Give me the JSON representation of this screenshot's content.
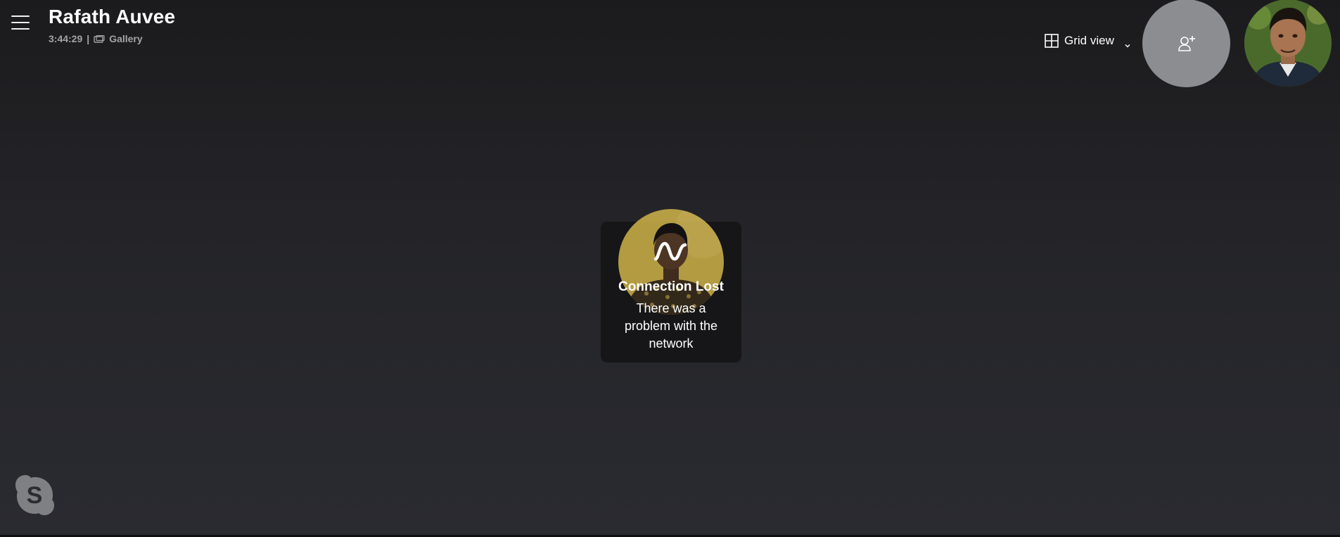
{
  "header": {
    "title": "Rafath Auvee",
    "duration": "3:44:29",
    "separator": "|",
    "gallery_label": "Gallery"
  },
  "view_toggle": {
    "label": "Grid view"
  },
  "connection_status": {
    "title": "Connection Lost",
    "message": "There was a problem with the network"
  },
  "icons": {
    "menu": "hamburger-menu-icon",
    "gallery": "gallery-icon",
    "grid": "grid-view-icon",
    "chevron": "chevron-down-icon",
    "add_person": "add-person-icon",
    "connection": "connection-wave-icon",
    "app": "skype-logo"
  },
  "colors": {
    "background": "#26272c",
    "card": "#161618",
    "add_person_bg": "#8b8d91",
    "avatar_ring": "#d6b94c"
  }
}
